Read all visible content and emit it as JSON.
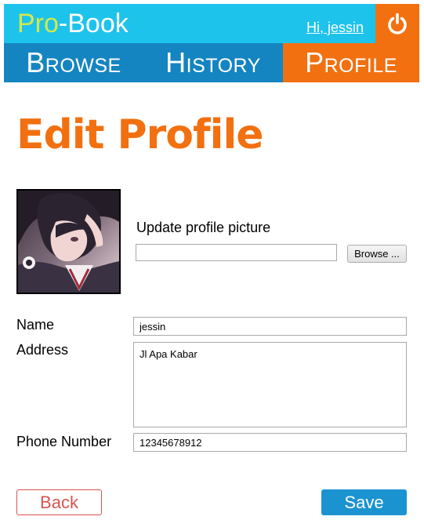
{
  "header": {
    "logo_prefix": "Pro",
    "logo_suffix": "-Book",
    "greeting": "Hi, jessin",
    "logout_icon": "power-icon",
    "colors": {
      "topbar": "#1ec3ec",
      "accent": "#f27010",
      "nav": "#1585c1",
      "logo_prefix": "#d4e84a"
    }
  },
  "nav": {
    "items": [
      {
        "label": "Browse",
        "active": false
      },
      {
        "label": "History",
        "active": false
      },
      {
        "label": "Profile",
        "active": true
      }
    ]
  },
  "page": {
    "title": "Edit Profile"
  },
  "profile_picture": {
    "label": "Update profile picture",
    "file_value": "",
    "browse_label": "Browse ..."
  },
  "form": {
    "name_label": "Name",
    "name_value": "jessin",
    "address_label": "Address",
    "address_value": "Jl Apa Kabar",
    "phone_label": "Phone Number",
    "phone_value": "12345678912"
  },
  "actions": {
    "back_label": "Back",
    "save_label": "Save",
    "colors": {
      "back": "#d9534f",
      "save": "#1c93d1"
    }
  }
}
